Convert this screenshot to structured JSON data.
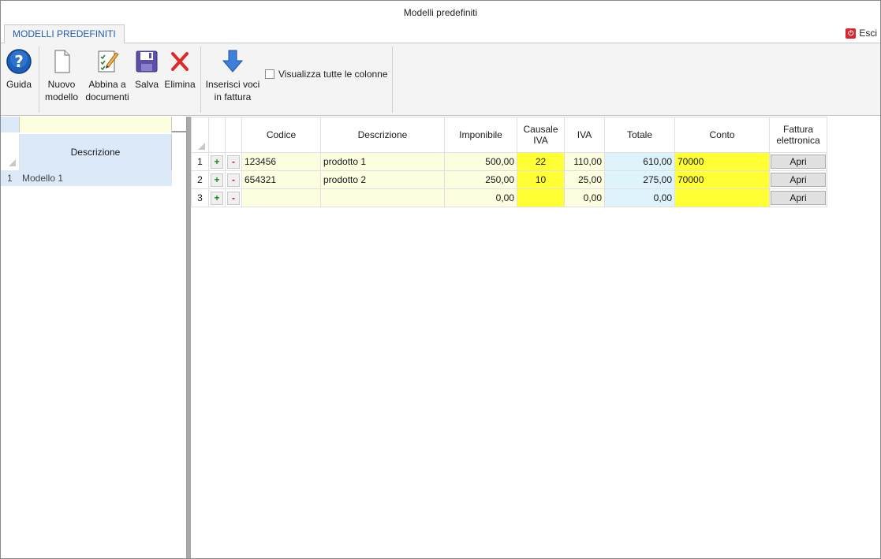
{
  "window": {
    "title": "Modelli predefiniti"
  },
  "tabs": [
    {
      "label": "MODELLI PREDEFINITI"
    }
  ],
  "exit": {
    "label": "Esci"
  },
  "toolbar": {
    "guida": "Guida",
    "nuovo_1": "Nuovo",
    "nuovo_2": "modello",
    "abbina_1": "Abbina a",
    "abbina_2": "documenti",
    "salva": "Salva",
    "elimina": "Elimina",
    "inserisci_1": "Inserisci voci",
    "inserisci_2": "in fattura",
    "show_all_columns": "Visualizza tutte le colonne"
  },
  "left_list": {
    "header": "Descrizione",
    "rows": [
      {
        "num": "1",
        "label": "Modello 1"
      }
    ]
  },
  "grid": {
    "columns": {
      "codice": "Codice",
      "descrizione": "Descrizione",
      "imponibile": "Imponibile",
      "causale_1": "Causale",
      "causale_2": "IVA",
      "iva": "IVA",
      "totale": "Totale",
      "conto": "Conto",
      "fattura_1": "Fattura",
      "fattura_2": "elettronica"
    },
    "plus": "+",
    "minus": "-",
    "apri": "Apri",
    "rows": [
      {
        "num": "1",
        "codice": "123456",
        "descrizione": "prodotto 1",
        "imponibile": "500,00",
        "causale": "22",
        "iva": "110,00",
        "totale": "610,00",
        "conto": "70000"
      },
      {
        "num": "2",
        "codice": "654321",
        "descrizione": "prodotto 2",
        "imponibile": "250,00",
        "causale": "10",
        "iva": "25,00",
        "totale": "275,00",
        "conto": "70000"
      },
      {
        "num": "3",
        "codice": "",
        "descrizione": "",
        "imponibile": "0,00",
        "causale": "",
        "iva": "0,00",
        "totale": "0,00",
        "conto": ""
      }
    ]
  }
}
